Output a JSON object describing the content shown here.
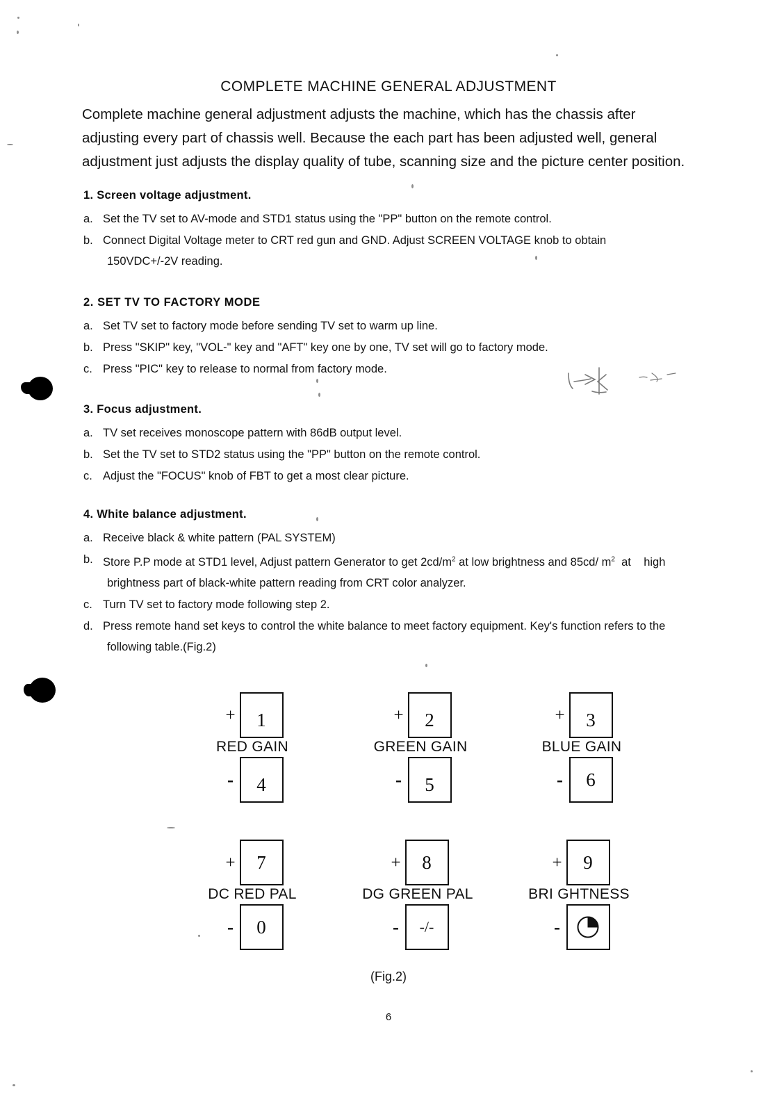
{
  "document": {
    "title": "COMPLETE MACHINE GENERAL ADJUSTMENT",
    "intro": "Complete machine general adjustment adjusts the machine, which has the chassis after adjusting every part of chassis well. Because the each part has been adjusted well, general adjustment just adjusts the display quality of tube, scanning size and the picture center position.",
    "page_number": "6",
    "figure_caption": "(Fig.2)"
  },
  "sections": [
    {
      "heading": "1. Screen voltage adjustment.",
      "items": [
        {
          "marker": "a.",
          "text": "Set the TV set to AV-mode and STD1 status using the \"PP\" button on the remote control.",
          "cont": ""
        },
        {
          "marker": "b.",
          "text": "Connect Digital Voltage meter to CRT red gun and GND. Adjust SCREEN VOLTAGE knob to obtain",
          "cont": "150VDC+/-2V reading."
        }
      ]
    },
    {
      "heading": "2. SET TV TO FACTORY MODE",
      "items": [
        {
          "marker": "a.",
          "text": "Set TV set to factory mode before sending TV set to warm up line.",
          "cont": ""
        },
        {
          "marker": "b.",
          "text": "Press \"SKIP\" key, \"VOL-\" key and \"AFT\" key one by one, TV set will go to factory mode.",
          "cont": ""
        },
        {
          "marker": "c.",
          "text": "Press \"PIC\" key to release to normal from factory mode.",
          "cont": ""
        }
      ]
    },
    {
      "heading": "3. Focus adjustment.",
      "items": [
        {
          "marker": "a.",
          "text": "TV set receives monoscope pattern with 86dB output level.",
          "cont": ""
        },
        {
          "marker": "b.",
          "text": "Set the TV set to STD2 status using the \"PP\" button on the remote control.",
          "cont": ""
        },
        {
          "marker": "c.",
          "text": "Adjust the \"FOCUS\" knob of FBT to get a most clear picture.",
          "cont": ""
        }
      ]
    },
    {
      "heading": "4. White balance adjustment.",
      "items": [
        {
          "marker": "a.",
          "text": "Receive black & white pattern (PAL SYSTEM)",
          "cont": ""
        },
        {
          "marker": "b",
          "text_html": true,
          "text": "Store P.P mode at STD1 level, Adjust pattern Generator to get 2cd/m2 at low brightness and 85cd/ m2  at    high",
          "cont": "brightness part of black-white pattern reading from CRT color analyzer."
        },
        {
          "marker": "c.",
          "text": "Turn TV set to factory mode following step 2.",
          "cont": ""
        },
        {
          "marker": "d.",
          "text": "Press remote hand set keys to control the white balance to meet factory equipment. Key's function refers to the",
          "cont": "following table.(Fig.2)"
        }
      ]
    }
  ],
  "figure": {
    "name": "remote-key-map",
    "groups": [
      {
        "label": "RED GAIN",
        "plus_sign": "+",
        "plus_key": "1",
        "minus_sign": "-",
        "minus_key": "4",
        "minus_icon": ""
      },
      {
        "label": "GREEN GAIN",
        "plus_sign": "+",
        "plus_key": "2",
        "minus_sign": "-",
        "minus_key": "5",
        "minus_icon": ""
      },
      {
        "label": "BLUE GAIN",
        "plus_sign": "+",
        "plus_key": "3",
        "minus_sign": "-",
        "minus_key": "6",
        "minus_icon": ""
      },
      {
        "label": "DC RED PAL",
        "plus_sign": "+",
        "plus_key": "7",
        "minus_sign": "-",
        "minus_key": "0",
        "minus_icon": ""
      },
      {
        "label": "DG GREEN PAL",
        "plus_sign": "+",
        "plus_key": "8",
        "minus_sign": "-",
        "minus_key": "-/-",
        "minus_icon": ""
      },
      {
        "label": "BRI GHTNESS",
        "plus_sign": "+",
        "plus_key": "9",
        "minus_sign": "-",
        "minus_key": "",
        "minus_icon": "pie-clock-icon"
      }
    ]
  },
  "colors": {
    "ink": "#111111",
    "paper": "#ffffff"
  }
}
